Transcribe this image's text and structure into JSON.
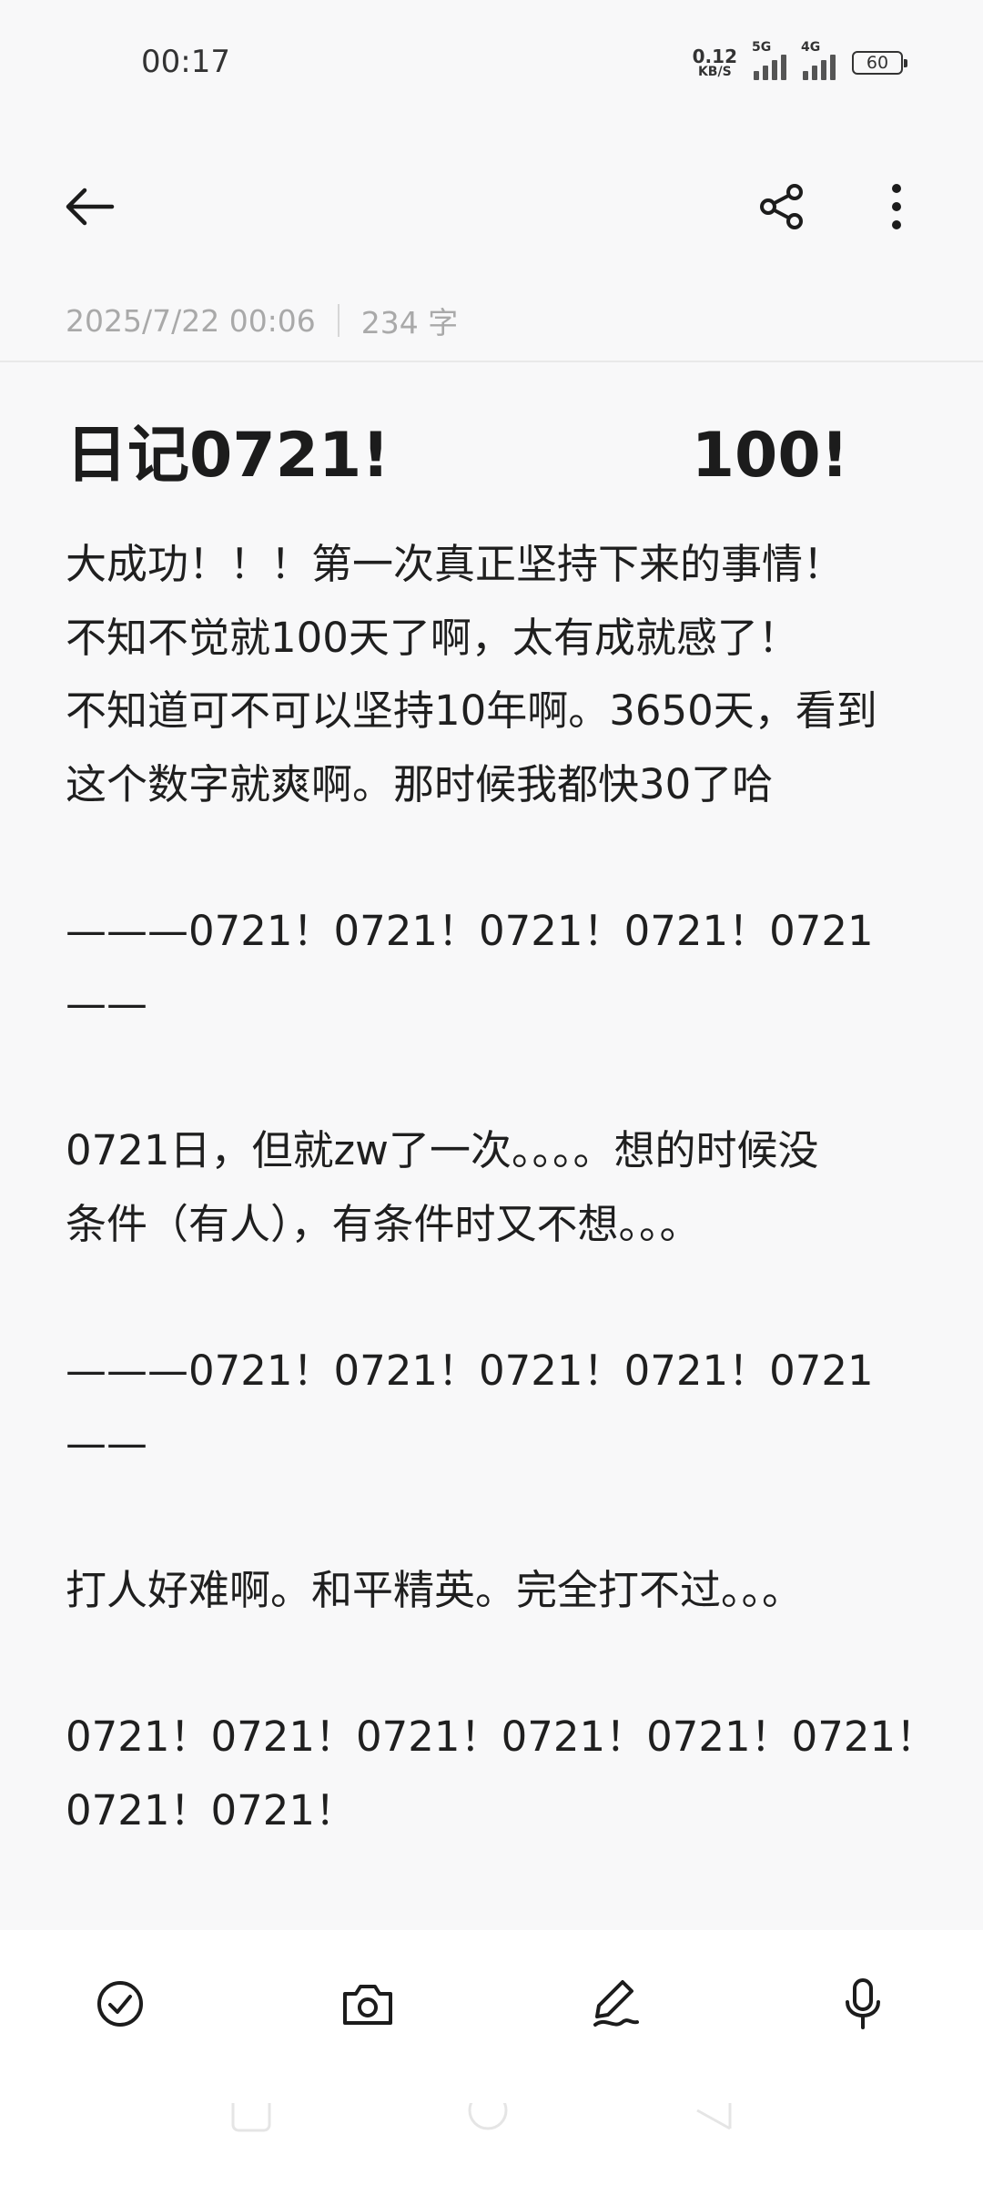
{
  "status_bar": {
    "time": "00:17",
    "net_speed_value": "0.12",
    "net_speed_unit": "KB/S",
    "sim1_type": "5G",
    "sim2_type": "4G",
    "battery": "60"
  },
  "toolbar": {
    "back_icon": "arrow-left-icon",
    "share_icon": "share-icon",
    "more_icon": "more-vertical-icon"
  },
  "note": {
    "date": "2025/7/22 00:06",
    "word_count": "234 字",
    "title": "日记0721!              100!",
    "body": "大成功！！！第一次真正坚持下来的事情！\n不知不觉就100天了啊，太有成就感了！\n不知道可不可以坚持10年啊。3650天，看到\n这个数字就爽啊。那时候我都快30了哈\n\n———0721！0721！0721！0721！0721——\n\n0721日，但就zw了一次。。。。想的时候没\n条件（有人），有条件时又不想。。。\n\n———0721！0721！0721！0721！0721——\n\n打人好难啊。和平精英。完全打不过。。。\n\n0721！0721！0721！0721！0721！0721！\n0721！0721！"
  },
  "bottom_toolbar": {
    "items": [
      "checklist-icon",
      "camera-icon",
      "handwriting-pen-icon",
      "microphone-icon"
    ]
  },
  "navigation_bar": {
    "items": [
      "recent-apps-icon",
      "home-icon",
      "back-nav-icon"
    ]
  }
}
